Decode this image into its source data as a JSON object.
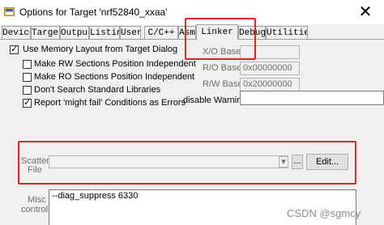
{
  "window": {
    "title": "Options for Target 'nrf52840_xxaa'",
    "close_glyph": "✕"
  },
  "tabs": [
    {
      "label": "Device"
    },
    {
      "label": "Target"
    },
    {
      "label": "Output"
    },
    {
      "label": "Listing"
    },
    {
      "label": "User"
    },
    {
      "label": "C/C++"
    },
    {
      "label": "Asm"
    },
    {
      "label": "Linker",
      "active": true
    },
    {
      "label": "Debug"
    },
    {
      "label": "Utilities"
    }
  ],
  "options": [
    {
      "label": "Use Memory Layout from Target Dialog",
      "checked": true
    },
    {
      "label": "Make RW Sections Position Independent",
      "checked": false
    },
    {
      "label": "Make RO Sections Position Independent",
      "checked": false
    },
    {
      "label": "Don't Search Standard Libraries",
      "checked": false
    },
    {
      "label": "Report 'might fail' Conditions as Errors",
      "checked": true
    }
  ],
  "check_glyph": "✓",
  "addresses": {
    "xo_label": "X/O Base:",
    "xo_value": "",
    "ro_label": "R/O Base:",
    "ro_value": "0x00000000",
    "rw_label": "R/W Base",
    "rw_value": "0x20000000"
  },
  "disable_warnings": {
    "label": "disable Warnings:",
    "value": ""
  },
  "scatter": {
    "label_line1": "Scatter",
    "label_line2": "File",
    "value": "",
    "browse_label": "...",
    "edit_label": "Edit..."
  },
  "misc": {
    "label_line1": "Misc",
    "label_line2": "controls",
    "value": "--diag_suppress 6330"
  },
  "watermark": "CSDN @sgmcy",
  "colors": {
    "highlight": "#e0202a"
  }
}
